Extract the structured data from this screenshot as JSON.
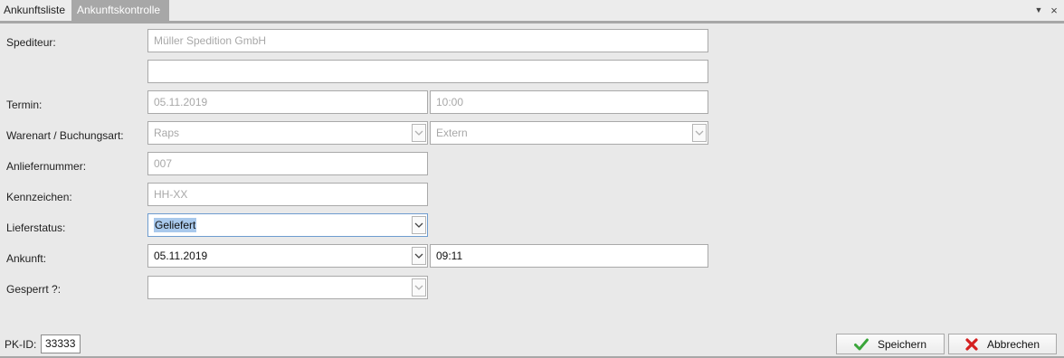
{
  "tabs": [
    {
      "label": "Ankunftsliste"
    },
    {
      "label": "Ankunftskontrolle"
    }
  ],
  "tab_controls": {
    "dropdown": "▼",
    "close": "×"
  },
  "form": {
    "spediteur": {
      "label": "Spediteur:",
      "value": "Müller Spedition GmbH",
      "value2": ""
    },
    "termin": {
      "label": "Termin:",
      "date": "05.11.2019",
      "time": "10:00"
    },
    "warenart": {
      "label": "Warenart / Buchungsart:",
      "warenart": "Raps",
      "buchungsart": "Extern"
    },
    "anliefernummer": {
      "label": "Anliefernummer:",
      "value": "007"
    },
    "kennzeichen": {
      "label": "Kennzeichen:",
      "value": "HH-XX"
    },
    "lieferstatus": {
      "label": "Lieferstatus:",
      "value": "Geliefert"
    },
    "ankunft": {
      "label": "Ankunft:",
      "date": "05.11.2019",
      "time": "09:11"
    },
    "gesperrt": {
      "label": "Gesperrt ?:",
      "value": ""
    }
  },
  "footer": {
    "pk_label": "PK-ID:",
    "pk_value": "33333",
    "save_label": "Speichern",
    "cancel_label": "Abbrechen"
  },
  "colors": {
    "accent_tab": "#a7a7a7",
    "save_icon": "#3aa53a",
    "cancel_icon": "#d42020",
    "selection": "#a9c9ec"
  }
}
